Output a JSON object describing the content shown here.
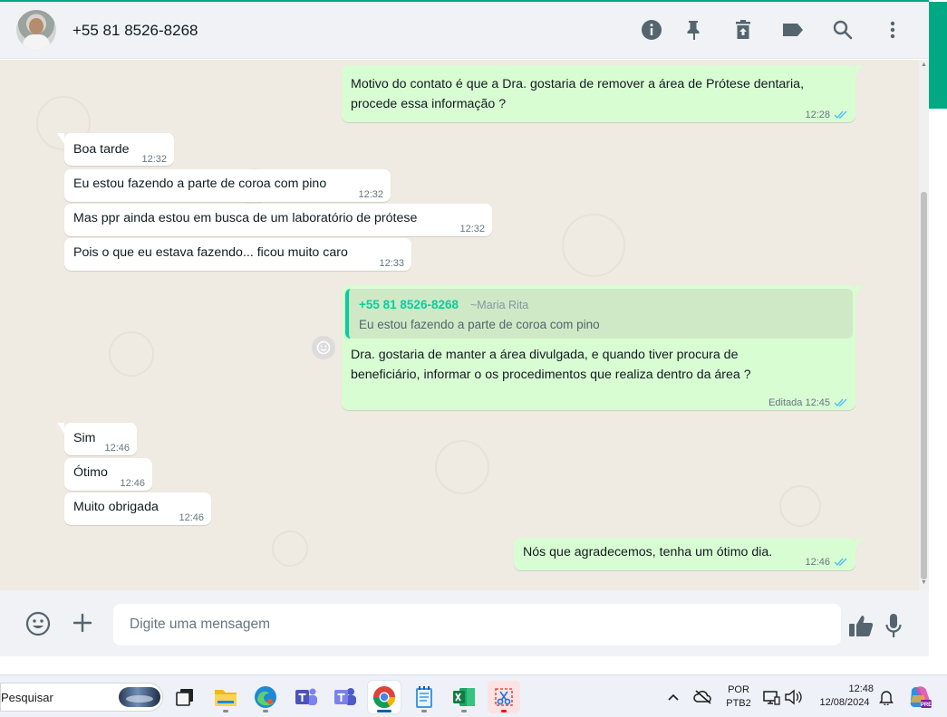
{
  "header": {
    "contact_name": "+55 81 8526-8268",
    "icons": [
      "info-icon",
      "pin-icon",
      "delete-icon",
      "label-icon",
      "search-icon",
      "menu-icon"
    ]
  },
  "messages": [
    {
      "dir": "out",
      "lines": [
        "Motivo do contato é que a Dra. gostaria de remover a área de Prótese dentaria,",
        "procede essa informação ?"
      ],
      "time": "12:28",
      "read": true
    },
    {
      "dir": "in",
      "lines": [
        "Boa tarde"
      ],
      "time": "12:32"
    },
    {
      "dir": "in",
      "lines": [
        "Eu estou fazendo a parte de coroa com pino"
      ],
      "time": "12:32"
    },
    {
      "dir": "in",
      "lines": [
        "Mas ppr ainda estou em busca de um laboratório de prótese"
      ],
      "time": "12:32"
    },
    {
      "dir": "in",
      "lines": [
        "Pois o que eu estava fazendo... ficou muito caro"
      ],
      "time": "12:33"
    },
    {
      "dir": "out",
      "quote": {
        "author": "+55 81 8526-8268",
        "alias": "~Maria Rita",
        "text": "Eu estou fazendo a parte de coroa com pino"
      },
      "lines": [
        "Dra. gostaria de manter a área divulgada, e quando tiver procura de",
        "beneficiário, informar o os procedimentos que realiza dentro da área ?"
      ],
      "edited_label": "Editada",
      "time": "12:45",
      "read": true
    },
    {
      "dir": "in",
      "lines": [
        "Sim"
      ],
      "time": "12:46"
    },
    {
      "dir": "in",
      "lines": [
        "Ótimo"
      ],
      "time": "12:46"
    },
    {
      "dir": "in",
      "lines": [
        "Muito obrigada"
      ],
      "time": "12:46"
    },
    {
      "dir": "out",
      "lines": [
        "Nós que agradecemos, tenha um ótimo dia."
      ],
      "time": "12:46",
      "read": true
    }
  ],
  "composer": {
    "placeholder": "Digite uma mensagem"
  },
  "taskbar": {
    "search_label": "Pesquisar",
    "language_line1": "POR",
    "language_line2": "PTB2",
    "clock_time": "12:48",
    "clock_date": "12/08/2024",
    "copilot_badge": "PRE"
  },
  "colors": {
    "accent": "#00a884",
    "outgoing_bubble": "#d9fdd3",
    "incoming_bubble": "#ffffff",
    "chat_background": "#efeae2",
    "read_ticks": "#53bdeb"
  }
}
